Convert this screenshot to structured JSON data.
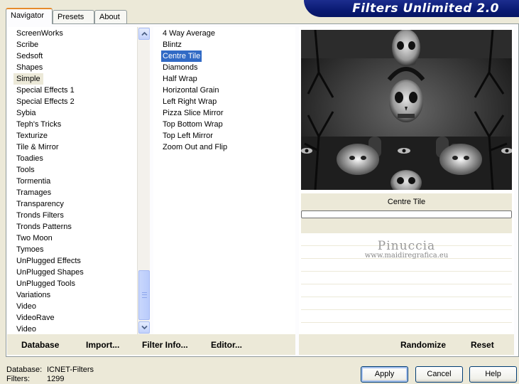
{
  "banner": {
    "title": "Filters Unlimited 2.0"
  },
  "tabs": [
    {
      "label": "Navigator",
      "active": true
    },
    {
      "label": "Presets",
      "active": false
    },
    {
      "label": "About",
      "active": false
    }
  ],
  "categories": {
    "items": [
      "ScreenWorks",
      "Scribe",
      "Sedsoft",
      "Shapes",
      "Simple",
      "Special Effects 1",
      "Special Effects 2",
      "Sybia",
      "Teph's Tricks",
      "Texturize",
      "Tile & Mirror",
      "Toadies",
      "Tools",
      "Tormentia",
      "Tramages",
      "Transparency",
      "Tronds Filters",
      "Tronds Patterns",
      "Two Moon",
      "Tymoes",
      "UnPlugged Effects",
      "UnPlugged Shapes",
      "UnPlugged Tools",
      "Variations",
      "Video",
      "VideoRave",
      "Video"
    ],
    "selected": "Simple"
  },
  "filters": {
    "items": [
      "4 Way Average",
      "Blintz",
      "Centre Tile",
      "Diamonds",
      "Half Wrap",
      "Horizontal Grain",
      "Left Right Wrap",
      "Pizza Slice Mirror",
      "Top Bottom Wrap",
      "Top Left Mirror",
      "Zoom Out and Flip"
    ],
    "selected": "Centre Tile"
  },
  "preview": {
    "filter_name": "Centre Tile",
    "progress": 0
  },
  "watermark": {
    "name": "Pinuccia",
    "url": "www.maidiregrafica.eu"
  },
  "left_actions": {
    "database": "Database",
    "import": "Import...",
    "filter_info": "Filter Info...",
    "editor": "Editor..."
  },
  "right_actions": {
    "randomize": "Randomize",
    "reset": "Reset"
  },
  "status": {
    "database_label": "Database:",
    "database_value": "ICNET-Filters",
    "filters_label": "Filters:",
    "filters_value": "1299"
  },
  "buttons": {
    "apply": "Apply",
    "cancel": "Cancel",
    "help": "Help"
  },
  "colors": {
    "selection": "#316ac5",
    "banner": "#0a1a73",
    "tab_accent": "#e68b2c"
  }
}
